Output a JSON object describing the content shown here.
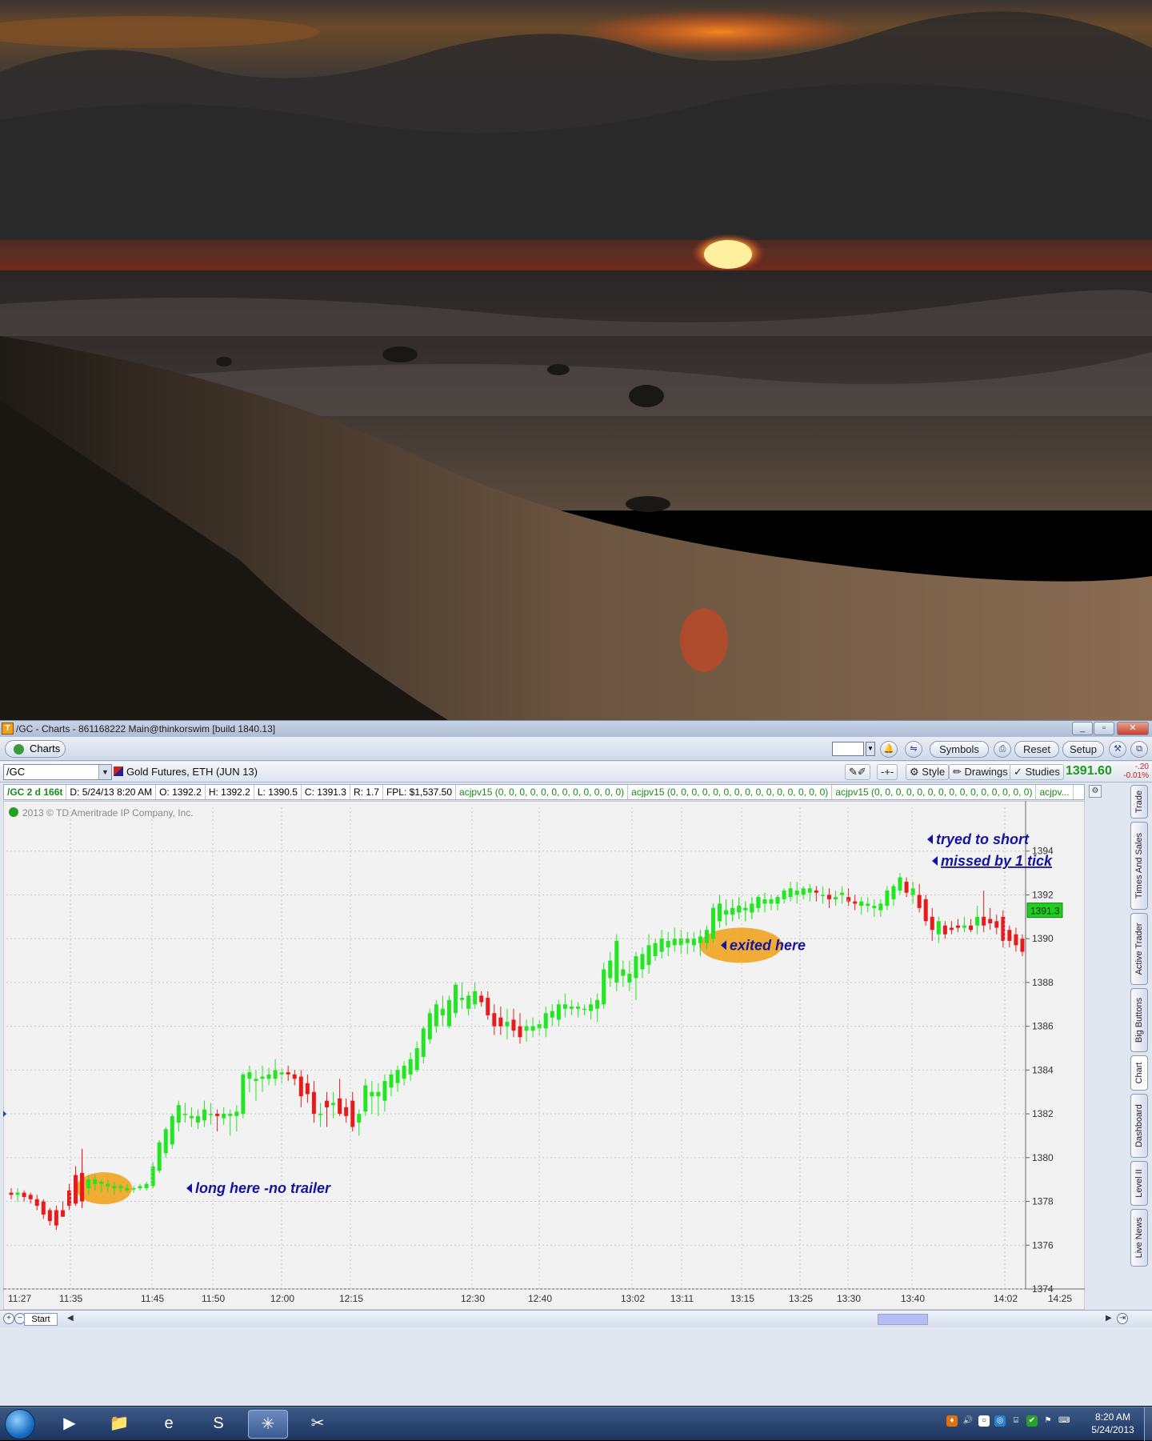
{
  "window": {
    "title": "/GC - Charts - 861168222 Main@thinkorswim [build 1840.13]"
  },
  "toolbar": {
    "tab_label": "Charts",
    "symbols_label": "Symbols",
    "reset_label": "Reset",
    "setup_label": "Setup"
  },
  "symbol_bar": {
    "symbol": "/GC",
    "description": "Gold Futures, ETH (JUN 13)",
    "style_label": "Style",
    "drawings_label": "Drawings",
    "studies_label": "Studies",
    "last_price": "1391.60",
    "change": "-.20",
    "change_pct": "-0.01%"
  },
  "info_bar": {
    "aggregation": "/GC 2 d 166t",
    "date": "D: 5/24/13 8:20 AM",
    "open": "O: 1392.2",
    "high": "H: 1392.2",
    "low": "L: 1390.5",
    "close": "C: 1391.3",
    "range": "R: 1.7",
    "fpl": "FPL: $1,537.50",
    "study1": "acjpv15 (0, 0, 0, 0, 0, 0, 0, 0, 0, 0, 0, 0)",
    "study2": "acjpv15 (0, 0, 0, 0, 0, 0, 0, 0, 0, 0, 0, 0, 0, 0, 0)",
    "study3": "acjpv15 (0, 0, 0, 0, 0, 0, 0, 0, 0, 0, 0, 0, 0, 0, 0)",
    "study4": "acjpv..."
  },
  "chart_data": {
    "type": "candlestick",
    "copyright": "2013 © TD Ameritrade IP Company, Inc.",
    "ylim": [
      1374,
      1396
    ],
    "y_ticks": [
      1374,
      1376,
      1378,
      1380,
      1382,
      1384,
      1386,
      1388,
      1390,
      1392,
      1394
    ],
    "x_ticks": [
      "11:27",
      "11:35",
      "11:45",
      "11:50",
      "12:00",
      "12:15",
      "12:30",
      "12:40",
      "13:02",
      "13:11",
      "13:15",
      "13:25",
      "13:30",
      "13:40",
      "14:02",
      "14:25"
    ],
    "last_price_label": "1391.3",
    "annotations": {
      "long": "long here  -no trailer",
      "exited": "exited here",
      "short1": "tryed to short",
      "short2": "missed by 1 tick"
    },
    "candles": [
      {
        "o": 1378.4,
        "h": 1378.6,
        "l": 1378.1,
        "c": 1378.3
      },
      {
        "o": 1378.3,
        "h": 1378.6,
        "l": 1378.0,
        "c": 1378.4
      },
      {
        "o": 1378.4,
        "h": 1378.5,
        "l": 1378.0,
        "c": 1378.2
      },
      {
        "o": 1378.3,
        "h": 1378.4,
        "l": 1377.9,
        "c": 1378.1
      },
      {
        "o": 1378.1,
        "h": 1378.3,
        "l": 1377.6,
        "c": 1377.8
      },
      {
        "o": 1378.0,
        "h": 1378.1,
        "l": 1377.2,
        "c": 1377.4
      },
      {
        "o": 1377.6,
        "h": 1377.7,
        "l": 1376.9,
        "c": 1377.1
      },
      {
        "o": 1377.6,
        "h": 1377.8,
        "l": 1376.7,
        "c": 1376.9
      },
      {
        "o": 1377.6,
        "h": 1378.0,
        "l": 1377.3,
        "c": 1377.3
      },
      {
        "o": 1378.5,
        "h": 1378.8,
        "l": 1377.6,
        "c": 1377.8
      },
      {
        "o": 1379.2,
        "h": 1379.6,
        "l": 1377.8,
        "c": 1377.9
      },
      {
        "o": 1379.3,
        "h": 1380.4,
        "l": 1377.7,
        "c": 1378.0
      },
      {
        "o": 1378.6,
        "h": 1379.2,
        "l": 1378.3,
        "c": 1379.0
      },
      {
        "o": 1378.8,
        "h": 1379.2,
        "l": 1378.5,
        "c": 1379.0
      },
      {
        "o": 1378.8,
        "h": 1379.0,
        "l": 1378.4,
        "c": 1378.9
      },
      {
        "o": 1378.7,
        "h": 1379.0,
        "l": 1378.4,
        "c": 1378.8
      },
      {
        "o": 1378.6,
        "h": 1378.9,
        "l": 1378.3,
        "c": 1378.7
      },
      {
        "o": 1378.6,
        "h": 1378.8,
        "l": 1378.4,
        "c": 1378.7
      },
      {
        "o": 1378.5,
        "h": 1378.8,
        "l": 1378.4,
        "c": 1378.6
      },
      {
        "o": 1378.6,
        "h": 1378.7,
        "l": 1378.4,
        "c": 1378.6
      },
      {
        "o": 1378.6,
        "h": 1378.8,
        "l": 1378.5,
        "c": 1378.7
      },
      {
        "o": 1378.6,
        "h": 1378.9,
        "l": 1378.5,
        "c": 1378.8
      },
      {
        "o": 1378.7,
        "h": 1379.8,
        "l": 1378.6,
        "c": 1379.6
      },
      {
        "o": 1379.4,
        "h": 1380.8,
        "l": 1379.3,
        "c": 1380.7
      },
      {
        "o": 1380.2,
        "h": 1381.4,
        "l": 1380.0,
        "c": 1381.3
      },
      {
        "o": 1380.6,
        "h": 1382.0,
        "l": 1380.4,
        "c": 1381.9
      },
      {
        "o": 1381.6,
        "h": 1382.6,
        "l": 1381.2,
        "c": 1382.4
      },
      {
        "o": 1382.0,
        "h": 1382.5,
        "l": 1381.6,
        "c": 1382.0
      },
      {
        "o": 1381.8,
        "h": 1382.3,
        "l": 1381.4,
        "c": 1381.9
      },
      {
        "o": 1381.6,
        "h": 1382.2,
        "l": 1381.3,
        "c": 1381.9
      },
      {
        "o": 1381.7,
        "h": 1382.6,
        "l": 1381.4,
        "c": 1382.2
      },
      {
        "o": 1382.0,
        "h": 1382.5,
        "l": 1381.5,
        "c": 1382.0
      },
      {
        "o": 1382.0,
        "h": 1382.2,
        "l": 1381.2,
        "c": 1381.9
      },
      {
        "o": 1381.8,
        "h": 1382.3,
        "l": 1381.5,
        "c": 1382.0
      },
      {
        "o": 1381.9,
        "h": 1382.2,
        "l": 1381.0,
        "c": 1382.0
      },
      {
        "o": 1381.9,
        "h": 1382.4,
        "l": 1381.2,
        "c": 1382.1
      },
      {
        "o": 1382.0,
        "h": 1383.9,
        "l": 1381.8,
        "c": 1383.8
      },
      {
        "o": 1383.6,
        "h": 1384.2,
        "l": 1383.0,
        "c": 1383.9
      },
      {
        "o": 1383.5,
        "h": 1384.0,
        "l": 1382.6,
        "c": 1383.6
      },
      {
        "o": 1383.6,
        "h": 1384.2,
        "l": 1383.0,
        "c": 1383.7
      },
      {
        "o": 1383.6,
        "h": 1384.1,
        "l": 1383.3,
        "c": 1383.8
      },
      {
        "o": 1383.6,
        "h": 1384.5,
        "l": 1383.3,
        "c": 1384.0
      },
      {
        "o": 1383.8,
        "h": 1384.1,
        "l": 1383.4,
        "c": 1383.9
      },
      {
        "o": 1383.9,
        "h": 1384.2,
        "l": 1383.5,
        "c": 1383.8
      },
      {
        "o": 1383.8,
        "h": 1384.0,
        "l": 1383.3,
        "c": 1383.6
      },
      {
        "o": 1383.7,
        "h": 1384.0,
        "l": 1382.3,
        "c": 1382.8
      },
      {
        "o": 1383.4,
        "h": 1383.8,
        "l": 1382.5,
        "c": 1382.9
      },
      {
        "o": 1383.0,
        "h": 1383.5,
        "l": 1381.6,
        "c": 1382.0
      },
      {
        "o": 1382.0,
        "h": 1382.5,
        "l": 1381.4,
        "c": 1382.0
      },
      {
        "o": 1382.6,
        "h": 1383.0,
        "l": 1381.4,
        "c": 1382.3
      },
      {
        "o": 1382.4,
        "h": 1383.0,
        "l": 1381.8,
        "c": 1382.5
      },
      {
        "o": 1382.7,
        "h": 1383.6,
        "l": 1381.9,
        "c": 1382.0
      },
      {
        "o": 1382.3,
        "h": 1382.7,
        "l": 1381.6,
        "c": 1381.9
      },
      {
        "o": 1382.6,
        "h": 1383.0,
        "l": 1381.2,
        "c": 1381.4
      },
      {
        "o": 1381.6,
        "h": 1382.2,
        "l": 1381.0,
        "c": 1382.0
      },
      {
        "o": 1382.1,
        "h": 1383.6,
        "l": 1381.9,
        "c": 1383.3
      },
      {
        "o": 1382.8,
        "h": 1383.5,
        "l": 1382.0,
        "c": 1383.0
      },
      {
        "o": 1382.8,
        "h": 1383.4,
        "l": 1381.9,
        "c": 1383.0
      },
      {
        "o": 1382.6,
        "h": 1383.8,
        "l": 1382.1,
        "c": 1383.5
      },
      {
        "o": 1383.2,
        "h": 1384.0,
        "l": 1382.8,
        "c": 1383.8
      },
      {
        "o": 1383.4,
        "h": 1384.2,
        "l": 1383.0,
        "c": 1384.0
      },
      {
        "o": 1383.6,
        "h": 1384.4,
        "l": 1383.3,
        "c": 1384.2
      },
      {
        "o": 1383.8,
        "h": 1384.8,
        "l": 1383.5,
        "c": 1384.5
      },
      {
        "o": 1384.0,
        "h": 1385.3,
        "l": 1383.9,
        "c": 1385.0
      },
      {
        "o": 1384.6,
        "h": 1386.0,
        "l": 1384.3,
        "c": 1385.9
      },
      {
        "o": 1385.4,
        "h": 1386.8,
        "l": 1385.2,
        "c": 1386.6
      },
      {
        "o": 1386.0,
        "h": 1387.2,
        "l": 1385.7,
        "c": 1387.0
      },
      {
        "o": 1386.5,
        "h": 1387.4,
        "l": 1386.0,
        "c": 1386.8
      },
      {
        "o": 1386.0,
        "h": 1387.4,
        "l": 1385.9,
        "c": 1387.2
      },
      {
        "o": 1386.6,
        "h": 1388.0,
        "l": 1386.4,
        "c": 1387.9
      },
      {
        "o": 1387.2,
        "h": 1388.0,
        "l": 1386.8,
        "c": 1387.3
      },
      {
        "o": 1386.8,
        "h": 1387.6,
        "l": 1386.5,
        "c": 1387.4
      },
      {
        "o": 1387.0,
        "h": 1388.0,
        "l": 1386.8,
        "c": 1387.6
      },
      {
        "o": 1387.4,
        "h": 1387.6,
        "l": 1386.9,
        "c": 1387.1
      },
      {
        "o": 1387.3,
        "h": 1387.6,
        "l": 1386.3,
        "c": 1386.5
      },
      {
        "o": 1386.6,
        "h": 1387.0,
        "l": 1385.6,
        "c": 1386.0
      },
      {
        "o": 1386.4,
        "h": 1386.9,
        "l": 1385.6,
        "c": 1386.0
      },
      {
        "o": 1386.0,
        "h": 1386.8,
        "l": 1385.4,
        "c": 1386.2
      },
      {
        "o": 1386.3,
        "h": 1386.8,
        "l": 1385.5,
        "c": 1385.8
      },
      {
        "o": 1386.0,
        "h": 1386.6,
        "l": 1385.2,
        "c": 1385.5
      },
      {
        "o": 1385.8,
        "h": 1386.3,
        "l": 1385.3,
        "c": 1386.0
      },
      {
        "o": 1385.8,
        "h": 1386.4,
        "l": 1385.5,
        "c": 1386.0
      },
      {
        "o": 1385.9,
        "h": 1386.3,
        "l": 1385.6,
        "c": 1386.1
      },
      {
        "o": 1385.9,
        "h": 1386.9,
        "l": 1385.5,
        "c": 1386.6
      },
      {
        "o": 1386.4,
        "h": 1387.0,
        "l": 1386.0,
        "c": 1386.7
      },
      {
        "o": 1386.3,
        "h": 1387.2,
        "l": 1386.0,
        "c": 1387.0
      },
      {
        "o": 1386.8,
        "h": 1387.5,
        "l": 1386.4,
        "c": 1387.0
      },
      {
        "o": 1386.8,
        "h": 1387.2,
        "l": 1386.5,
        "c": 1386.9
      },
      {
        "o": 1386.8,
        "h": 1387.1,
        "l": 1386.4,
        "c": 1386.9
      },
      {
        "o": 1386.8,
        "h": 1387.0,
        "l": 1386.5,
        "c": 1386.8
      },
      {
        "o": 1386.7,
        "h": 1387.3,
        "l": 1386.3,
        "c": 1387.0
      },
      {
        "o": 1386.8,
        "h": 1387.5,
        "l": 1386.2,
        "c": 1387.2
      },
      {
        "o": 1387.0,
        "h": 1388.9,
        "l": 1386.8,
        "c": 1388.6
      },
      {
        "o": 1388.2,
        "h": 1389.4,
        "l": 1387.8,
        "c": 1389.0
      },
      {
        "o": 1388.0,
        "h": 1390.2,
        "l": 1387.6,
        "c": 1389.9
      },
      {
        "o": 1388.3,
        "h": 1389.0,
        "l": 1387.8,
        "c": 1388.6
      },
      {
        "o": 1388.0,
        "h": 1389.0,
        "l": 1387.6,
        "c": 1388.4
      },
      {
        "o": 1388.2,
        "h": 1389.4,
        "l": 1387.2,
        "c": 1389.2
      },
      {
        "o": 1388.6,
        "h": 1389.6,
        "l": 1388.2,
        "c": 1389.3
      },
      {
        "o": 1388.8,
        "h": 1390.2,
        "l": 1388.4,
        "c": 1389.7
      },
      {
        "o": 1389.2,
        "h": 1390.0,
        "l": 1389.0,
        "c": 1389.8
      },
      {
        "o": 1389.4,
        "h": 1390.4,
        "l": 1389.1,
        "c": 1390.0
      },
      {
        "o": 1389.6,
        "h": 1390.3,
        "l": 1389.2,
        "c": 1389.9
      },
      {
        "o": 1389.7,
        "h": 1390.5,
        "l": 1389.4,
        "c": 1390.0
      },
      {
        "o": 1389.7,
        "h": 1390.4,
        "l": 1389.3,
        "c": 1390.0
      },
      {
        "o": 1389.8,
        "h": 1390.3,
        "l": 1389.3,
        "c": 1390.0
      },
      {
        "o": 1389.7,
        "h": 1390.3,
        "l": 1389.4,
        "c": 1390.0
      },
      {
        "o": 1389.8,
        "h": 1390.4,
        "l": 1389.2,
        "c": 1390.1
      },
      {
        "o": 1389.8,
        "h": 1390.6,
        "l": 1389.5,
        "c": 1390.4
      },
      {
        "o": 1390.0,
        "h": 1391.6,
        "l": 1389.8,
        "c": 1391.4
      },
      {
        "o": 1390.8,
        "h": 1392.0,
        "l": 1390.5,
        "c": 1391.6
      },
      {
        "o": 1391.1,
        "h": 1391.8,
        "l": 1390.6,
        "c": 1391.3
      },
      {
        "o": 1391.1,
        "h": 1391.8,
        "l": 1390.8,
        "c": 1391.4
      },
      {
        "o": 1391.2,
        "h": 1391.9,
        "l": 1390.9,
        "c": 1391.5
      },
      {
        "o": 1391.3,
        "h": 1391.7,
        "l": 1390.8,
        "c": 1391.4
      },
      {
        "o": 1391.2,
        "h": 1391.9,
        "l": 1390.9,
        "c": 1391.6
      },
      {
        "o": 1391.4,
        "h": 1392.0,
        "l": 1391.2,
        "c": 1391.9
      },
      {
        "o": 1391.6,
        "h": 1392.1,
        "l": 1391.2,
        "c": 1391.8
      },
      {
        "o": 1391.6,
        "h": 1392.0,
        "l": 1391.3,
        "c": 1391.8
      },
      {
        "o": 1391.6,
        "h": 1392.0,
        "l": 1391.3,
        "c": 1391.9
      },
      {
        "o": 1391.8,
        "h": 1392.3,
        "l": 1391.6,
        "c": 1392.2
      },
      {
        "o": 1391.9,
        "h": 1392.6,
        "l": 1391.7,
        "c": 1392.3
      },
      {
        "o": 1392.0,
        "h": 1392.6,
        "l": 1391.6,
        "c": 1392.2
      },
      {
        "o": 1392.0,
        "h": 1392.4,
        "l": 1391.8,
        "c": 1392.3
      },
      {
        "o": 1392.1,
        "h": 1392.5,
        "l": 1391.7,
        "c": 1392.3
      },
      {
        "o": 1392.2,
        "h": 1392.4,
        "l": 1391.7,
        "c": 1392.1
      },
      {
        "o": 1392.0,
        "h": 1392.4,
        "l": 1391.6,
        "c": 1392.0
      },
      {
        "o": 1392.0,
        "h": 1392.3,
        "l": 1391.4,
        "c": 1391.8
      },
      {
        "o": 1391.8,
        "h": 1392.2,
        "l": 1391.5,
        "c": 1391.9
      },
      {
        "o": 1392.0,
        "h": 1392.4,
        "l": 1391.6,
        "c": 1392.1
      },
      {
        "o": 1391.9,
        "h": 1392.3,
        "l": 1391.5,
        "c": 1391.7
      },
      {
        "o": 1391.7,
        "h": 1392.0,
        "l": 1391.3,
        "c": 1391.6
      },
      {
        "o": 1391.5,
        "h": 1391.9,
        "l": 1391.1,
        "c": 1391.7
      },
      {
        "o": 1391.5,
        "h": 1391.9,
        "l": 1391.2,
        "c": 1391.6
      },
      {
        "o": 1391.4,
        "h": 1391.8,
        "l": 1391.0,
        "c": 1391.5
      },
      {
        "o": 1391.3,
        "h": 1391.8,
        "l": 1391.0,
        "c": 1391.6
      },
      {
        "o": 1391.5,
        "h": 1392.4,
        "l": 1391.3,
        "c": 1392.2
      },
      {
        "o": 1391.8,
        "h": 1392.5,
        "l": 1391.5,
        "c": 1392.4
      },
      {
        "o": 1392.2,
        "h": 1393.0,
        "l": 1392.0,
        "c": 1392.8
      },
      {
        "o": 1392.6,
        "h": 1392.8,
        "l": 1391.9,
        "c": 1392.1
      },
      {
        "o": 1392.0,
        "h": 1392.6,
        "l": 1391.6,
        "c": 1392.3
      },
      {
        "o": 1392.0,
        "h": 1392.5,
        "l": 1391.2,
        "c": 1391.4
      },
      {
        "o": 1391.8,
        "h": 1392.0,
        "l": 1390.6,
        "c": 1390.8
      },
      {
        "o": 1391.0,
        "h": 1391.4,
        "l": 1389.9,
        "c": 1390.4
      },
      {
        "o": 1390.2,
        "h": 1391.0,
        "l": 1389.8,
        "c": 1390.8
      },
      {
        "o": 1390.6,
        "h": 1390.8,
        "l": 1390.0,
        "c": 1390.2
      },
      {
        "o": 1390.5,
        "h": 1390.8,
        "l": 1390.2,
        "c": 1390.4
      },
      {
        "o": 1390.6,
        "h": 1390.9,
        "l": 1390.3,
        "c": 1390.5
      },
      {
        "o": 1390.5,
        "h": 1391.0,
        "l": 1390.3,
        "c": 1390.6
      },
      {
        "o": 1390.6,
        "h": 1390.9,
        "l": 1390.3,
        "c": 1390.4
      },
      {
        "o": 1390.6,
        "h": 1391.5,
        "l": 1390.2,
        "c": 1391.0
      },
      {
        "o": 1391.0,
        "h": 1392.2,
        "l": 1390.3,
        "c": 1390.6
      },
      {
        "o": 1390.9,
        "h": 1391.4,
        "l": 1390.4,
        "c": 1390.7
      },
      {
        "o": 1390.8,
        "h": 1391.1,
        "l": 1390.2,
        "c": 1390.5
      },
      {
        "o": 1391.0,
        "h": 1391.3,
        "l": 1389.6,
        "c": 1389.9
      },
      {
        "o": 1390.4,
        "h": 1390.6,
        "l": 1389.6,
        "c": 1389.9
      },
      {
        "o": 1390.2,
        "h": 1390.5,
        "l": 1389.4,
        "c": 1389.7
      },
      {
        "o": 1390.0,
        "h": 1390.2,
        "l": 1389.2,
        "c": 1389.4
      }
    ]
  },
  "side_tabs": [
    "Trade",
    "Times And Sales",
    "Active Trader",
    "Big Buttons",
    "Chart",
    "Dashboard",
    "Level II",
    "Live News"
  ],
  "scroll": {
    "start_label": "Start"
  },
  "taskbar": {
    "time": "8:20 AM",
    "date": "5/24/2013",
    "apps": [
      "media-player",
      "file-explorer",
      "internet-explorer",
      "skype",
      "thinkorswim",
      "snipping-tool"
    ]
  },
  "colors": {
    "up": "#22e622",
    "down": "#e61c1c",
    "annotation": "#1414a0",
    "highlight": "#f0a014",
    "price_tag": "#22cc22"
  }
}
